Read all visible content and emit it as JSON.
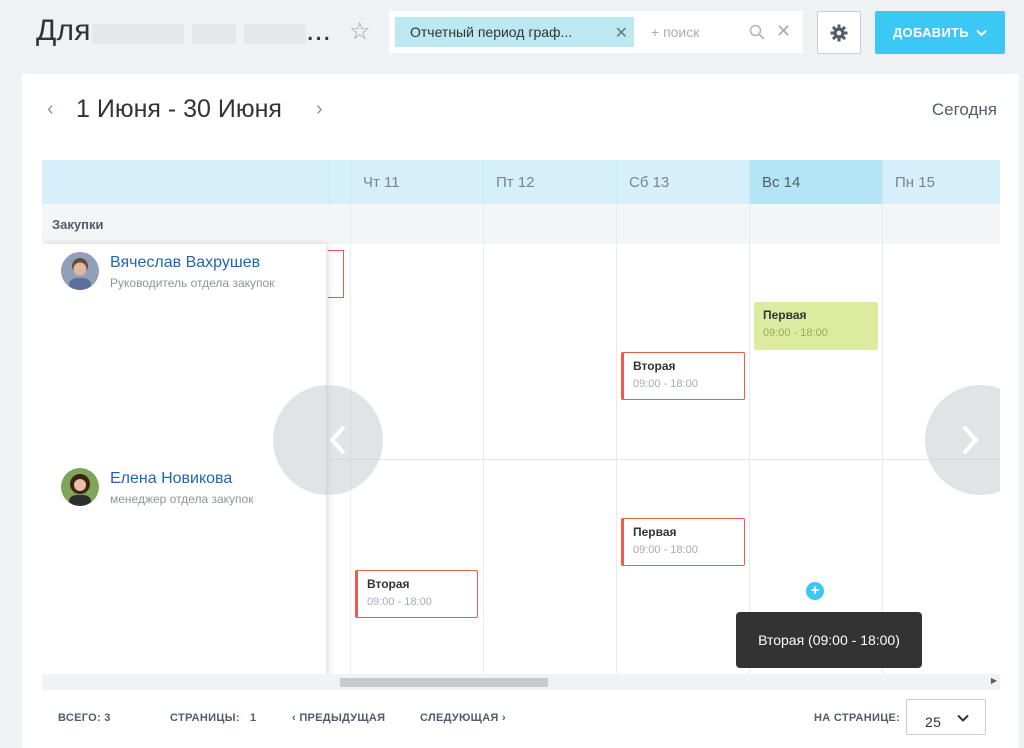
{
  "header": {
    "title_prefix": "Для",
    "title_ellipsis": "...",
    "filter_chip": "Отчетный период граф...",
    "search_placeholder": "+ поиск",
    "add_button": "ДОБАВИТЬ"
  },
  "calendar": {
    "period": "1 Июня - 30 Июня",
    "today_button": "Сегодня",
    "group": "Закупки",
    "days": [
      "Чт 11",
      "Пт 12",
      "Сб 13",
      "Вс 14",
      "Пн 15"
    ],
    "active_day": "Вс 14",
    "people": [
      {
        "name": "Вячеслав Вахрушев",
        "role": "Руководитель отдела закупок"
      },
      {
        "name": "Елена Новикова",
        "role": "менеджер отдела закупок"
      }
    ],
    "shifts": [
      {
        "title": "Первая",
        "time": "09:00 - 18:00"
      },
      {
        "title": "Вторая",
        "time": "09:00 - 18:00"
      },
      {
        "title": "Первая",
        "time": "09:00 - 18:00"
      },
      {
        "title": "Вторая",
        "time": "09:00 - 18:00"
      }
    ],
    "tooltip": "Вторая (09:00 - 18:00)"
  },
  "footer": {
    "total": "ВСЕГО: 3",
    "pages": "СТРАНИЦЫ:",
    "page_number": "1",
    "prev": "ПРЕДЫДУЩАЯ",
    "next": "СЛЕДУЮЩАЯ",
    "per_page_label": "НА СТРАНИЦЕ:",
    "per_page_value": "25"
  },
  "colors": {
    "accent": "#3bc8f5",
    "shift_border": "#f05a4a",
    "shift_green": "#dceba0",
    "header_band": "#d5f0fa"
  }
}
